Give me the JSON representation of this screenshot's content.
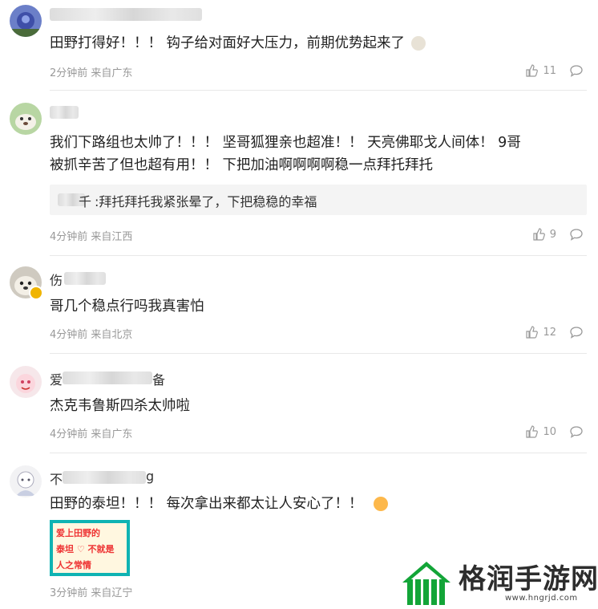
{
  "comments": [
    {
      "name_suffix": "",
      "text": "田野打得好！！！ 钩子给对面好大压力，前期优势起来了",
      "meta": "2分钟前 来自广东",
      "likes": "11"
    },
    {
      "name_suffix": "",
      "text_line1": "我们下路组也太帅了！！！ 坚哥狐狸亲也超准！！ 天亮佛耶戈人间体！ 9哥",
      "text_line2": "被抓辛苦了但也超有用！！ 下把加油啊啊啊啊稳一点拜托拜托",
      "reply_prefix": "千",
      "reply_text": ":拜托拜托我紧张晕了，下把稳稳的幸福",
      "meta": "4分钟前 来自江西",
      "likes": "9"
    },
    {
      "name_prefix": "伤",
      "text": "哥几个稳点行吗我真害怕",
      "meta": "4分钟前 来自北京",
      "likes": "12"
    },
    {
      "name_prefix": "爱",
      "name_suffix": "备",
      "text": "杰克韦鲁斯四杀太帅啦",
      "meta": "4分钟前 来自广东",
      "likes": "10"
    },
    {
      "name_prefix": "不",
      "name_suffix": "g",
      "text": "田野的泰坦！！！ 每次拿出来都太让人安心了！！",
      "meta": "3分钟前 来自辽宁",
      "sticker_lines": [
        "爱上田野的",
        "泰坦 ♡ 不就是",
        "人之常情"
      ]
    }
  ],
  "watermark": {
    "text": "格润手游网",
    "url": "www.hngrjd.com"
  },
  "colors": {
    "accent": "#13a538",
    "meta": "#999999"
  }
}
